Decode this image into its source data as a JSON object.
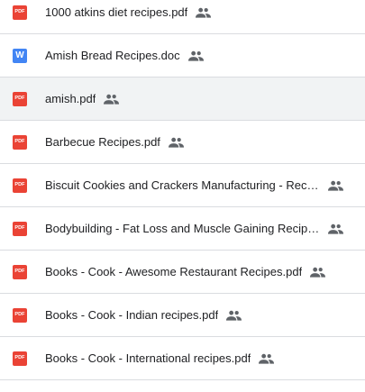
{
  "files": [
    {
      "name": "1000 atkins diet recipes.pdf",
      "type": "pdf",
      "icon": "pdf-file-icon",
      "icon_text": "PDF",
      "shared": true,
      "shared_icon": "shared-people-icon",
      "hover": false
    },
    {
      "name": "Amish Bread Recipes.doc",
      "type": "doc",
      "icon": "word-doc-file-icon",
      "icon_text": "W",
      "shared": true,
      "shared_icon": "shared-people-icon",
      "hover": false
    },
    {
      "name": "amish.pdf",
      "type": "pdf",
      "icon": "pdf-file-icon",
      "icon_text": "PDF",
      "shared": true,
      "shared_icon": "shared-people-icon",
      "hover": true
    },
    {
      "name": "Barbecue Recipes.pdf",
      "type": "pdf",
      "icon": "pdf-file-icon",
      "icon_text": "PDF",
      "shared": true,
      "shared_icon": "shared-people-icon",
      "hover": false
    },
    {
      "name": "Biscuit Cookies and Crackers Manufacturing - Recipe...",
      "type": "pdf",
      "icon": "pdf-file-icon",
      "icon_text": "PDF",
      "shared": true,
      "shared_icon": "shared-people-icon",
      "hover": false
    },
    {
      "name": "Bodybuilding - Fat Loss and Muscle Gaining Recipes....",
      "type": "pdf",
      "icon": "pdf-file-icon",
      "icon_text": "PDF",
      "shared": true,
      "shared_icon": "shared-people-icon",
      "hover": false
    },
    {
      "name": "Books - Cook - Awesome Restaurant Recipes.pdf",
      "type": "pdf",
      "icon": "pdf-file-icon",
      "icon_text": "PDF",
      "shared": true,
      "shared_icon": "shared-people-icon",
      "hover": false
    },
    {
      "name": "Books - Cook - Indian recipes.pdf",
      "type": "pdf",
      "icon": "pdf-file-icon",
      "icon_text": "PDF",
      "shared": true,
      "shared_icon": "shared-people-icon",
      "hover": false
    },
    {
      "name": "Books - Cook - International recipes.pdf",
      "type": "pdf",
      "icon": "pdf-file-icon",
      "icon_text": "PDF",
      "shared": true,
      "shared_icon": "shared-people-icon",
      "hover": false
    }
  ],
  "colors": {
    "pdf_red": "#ea4335",
    "doc_blue": "#4285f4",
    "text": "#202124",
    "shared_icon_grey": "#5f6368",
    "divider": "#dadce0",
    "hover_bg": "#f1f3f4"
  }
}
